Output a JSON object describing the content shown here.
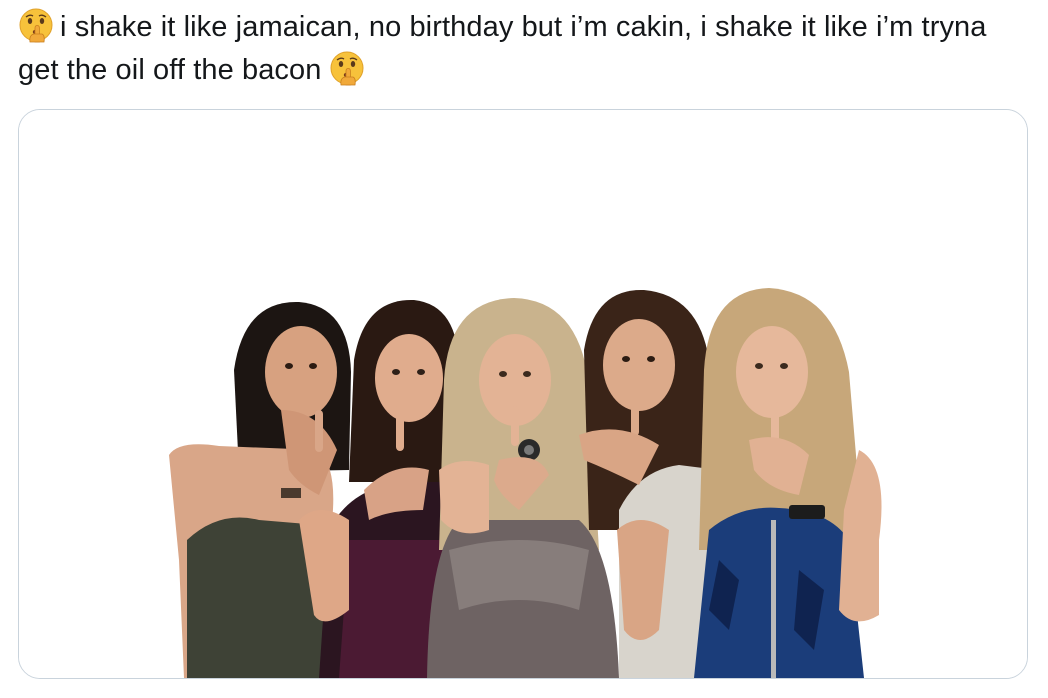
{
  "tweet": {
    "emoji_start": "shushing-face-emoji",
    "text": "i shake it like jamaican, no birthday but i’m cakin, i shake it like i’m tryna get the oil off the bacon",
    "emoji_end": "shushing-face-emoji"
  },
  "media": {
    "subject": "five-women-shushing-photo",
    "colors": {
      "card_border": "#c9d3dc",
      "background": "#ffffff"
    }
  }
}
